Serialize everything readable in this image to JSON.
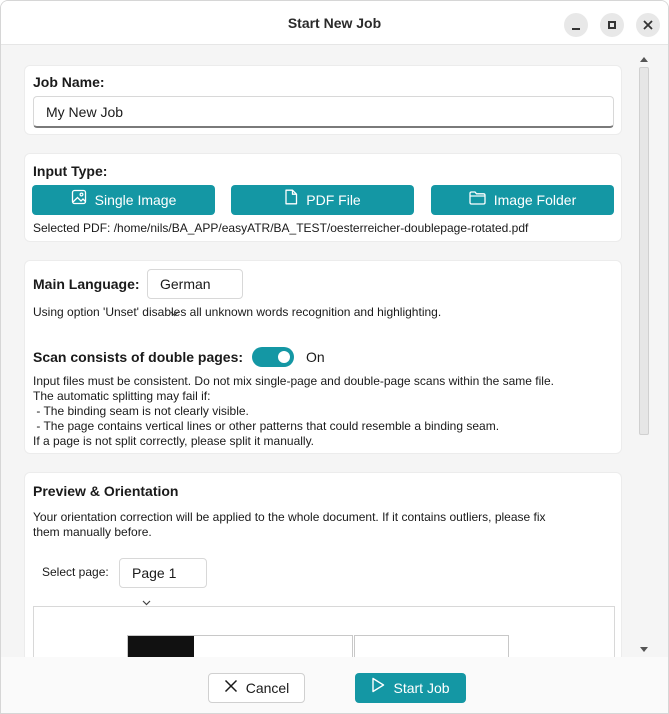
{
  "window": {
    "title": "Start New Job",
    "controls": [
      "minimize",
      "maximize",
      "close"
    ]
  },
  "job_name": {
    "label": "Job Name:",
    "value": "My New Job"
  },
  "input_type": {
    "label": "Input Type:",
    "buttons": {
      "single_image": "Single Image",
      "pdf_file": "PDF File",
      "image_folder": "Image Folder"
    },
    "selected_text": "Selected PDF: /home/nils/BA_APP/easyATR/BA_TEST/oesterreicher-doublepage-rotated.pdf"
  },
  "language": {
    "label": "Main Language:",
    "selected": "German",
    "hint": "Using option 'Unset' disables all unknown words recognition and highlighting."
  },
  "double_pages": {
    "label": "Scan consists of double pages:",
    "toggle_state": "On",
    "toggle_on": true,
    "info_lines": [
      "Input files must be consistent. Do not mix single-page and double-page scans within the same file.",
      "The automatic splitting may fail if:",
      " - The binding seam is not clearly visible.",
      " - The page contains vertical lines or other patterns that could resemble a binding seam.",
      "If a page is not split correctly, please split it manually."
    ]
  },
  "preview": {
    "label": "Preview & Orientation",
    "info_line1": "Your orientation correction will be applied to the whole document. If it contains outliers, please fix",
    "info_line2": "them manually before.",
    "select_label": "Select page:",
    "selected_page": "Page 1"
  },
  "footer": {
    "cancel_label": "Cancel",
    "start_label": "Start Job"
  },
  "colors": {
    "accent": "#1497a4",
    "background": "#f5f5f5",
    "card": "#ffffff"
  },
  "icons": {
    "single_image": "image-icon",
    "pdf_file": "file-icon",
    "image_folder": "folder-icon",
    "cancel": "x-icon",
    "start": "play-icon"
  }
}
